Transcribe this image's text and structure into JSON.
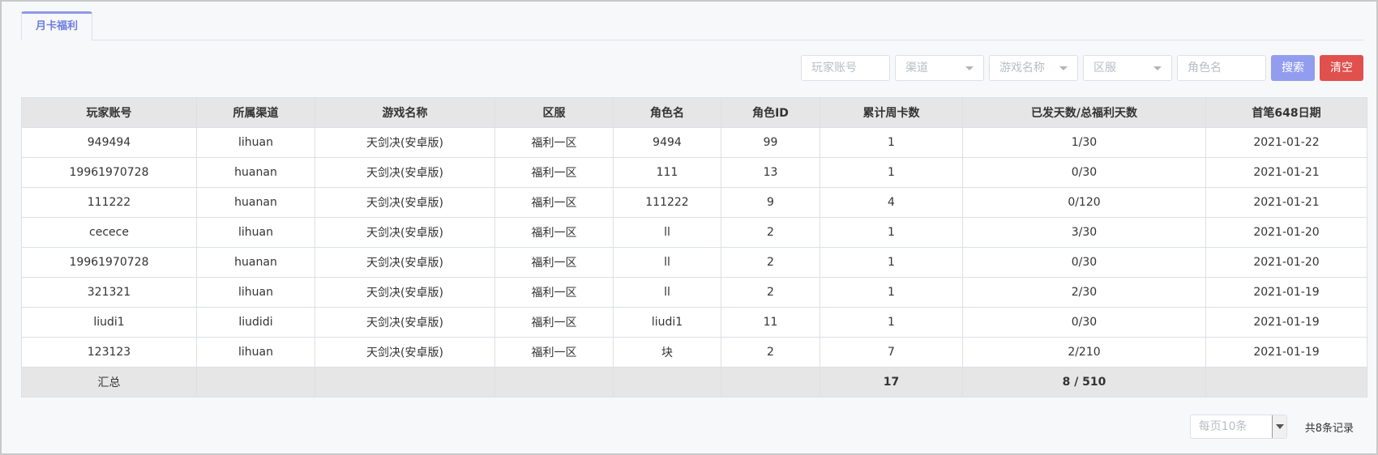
{
  "tabs": [
    {
      "label": "月卡福利"
    }
  ],
  "filters": {
    "account_placeholder": "玩家账号",
    "channel_placeholder": "渠道",
    "game_placeholder": "游戏名称",
    "server_placeholder": "区服",
    "role_placeholder": "角色名",
    "search_label": "搜索",
    "clear_label": "清空"
  },
  "table": {
    "headers": [
      "玩家账号",
      "所属渠道",
      "游戏名称",
      "区服",
      "角色名",
      "角色ID",
      "累计周卡数",
      "已发天数/总福利天数",
      "首笔648日期"
    ],
    "rows": [
      [
        "949494",
        "lihuan",
        "天剑决(安卓版)",
        "福利一区",
        "9494",
        "99",
        "1",
        "1/30",
        "2021-01-22"
      ],
      [
        "19961970728",
        "huanan",
        "天剑决(安卓版)",
        "福利一区",
        "111",
        "13",
        "1",
        "0/30",
        "2021-01-21"
      ],
      [
        "111222",
        "huanan",
        "天剑决(安卓版)",
        "福利一区",
        "111222",
        "9",
        "4",
        "0/120",
        "2021-01-21"
      ],
      [
        "cecece",
        "lihuan",
        "天剑决(安卓版)",
        "福利一区",
        "ll",
        "2",
        "1",
        "3/30",
        "2021-01-20"
      ],
      [
        "19961970728",
        "huanan",
        "天剑决(安卓版)",
        "福利一区",
        "ll",
        "2",
        "1",
        "0/30",
        "2021-01-20"
      ],
      [
        "321321",
        "lihuan",
        "天剑决(安卓版)",
        "福利一区",
        "ll",
        "2",
        "1",
        "2/30",
        "2021-01-19"
      ],
      [
        "liudi1",
        "liudidi",
        "天剑决(安卓版)",
        "福利一区",
        "liudi1",
        "11",
        "1",
        "0/30",
        "2021-01-19"
      ],
      [
        "123123",
        "lihuan",
        "天剑决(安卓版)",
        "福利一区",
        "块",
        "2",
        "7",
        "2/210",
        "2021-01-19"
      ]
    ],
    "summary": [
      "汇总",
      "",
      "",
      "",
      "",
      "",
      "17",
      "8 / 510",
      ""
    ]
  },
  "pager": {
    "page_size": "每页10条",
    "total": "共8条记录"
  },
  "colors": {
    "accent": "#939df0",
    "danger": "#e0504d",
    "header_bg": "#e6e6e6"
  }
}
